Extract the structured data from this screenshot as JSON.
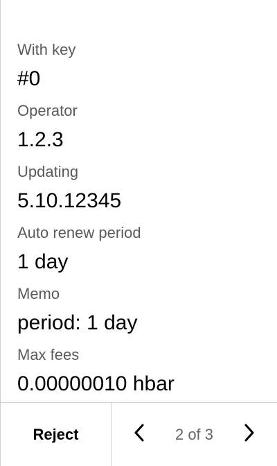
{
  "fields": [
    {
      "label": "With key",
      "value": "#0"
    },
    {
      "label": "Operator",
      "value": "1.2.3"
    },
    {
      "label": "Updating",
      "value": "5.10.12345"
    },
    {
      "label": "Auto renew period",
      "value": "1 day"
    },
    {
      "label": "Memo",
      "value": "period: 1 day"
    },
    {
      "label": "Max fees",
      "value": "0.00000010 hbar"
    }
  ],
  "footer": {
    "reject_label": "Reject",
    "page_current": "2",
    "page_separator": " of ",
    "page_total": "3",
    "prev_icon": "chevron-left-icon",
    "next_icon": "chevron-right-icon"
  },
  "colors": {
    "label": "#5a5a5a",
    "value": "#000000",
    "divider": "#cfcfcf",
    "page_indicator": "#666666"
  }
}
